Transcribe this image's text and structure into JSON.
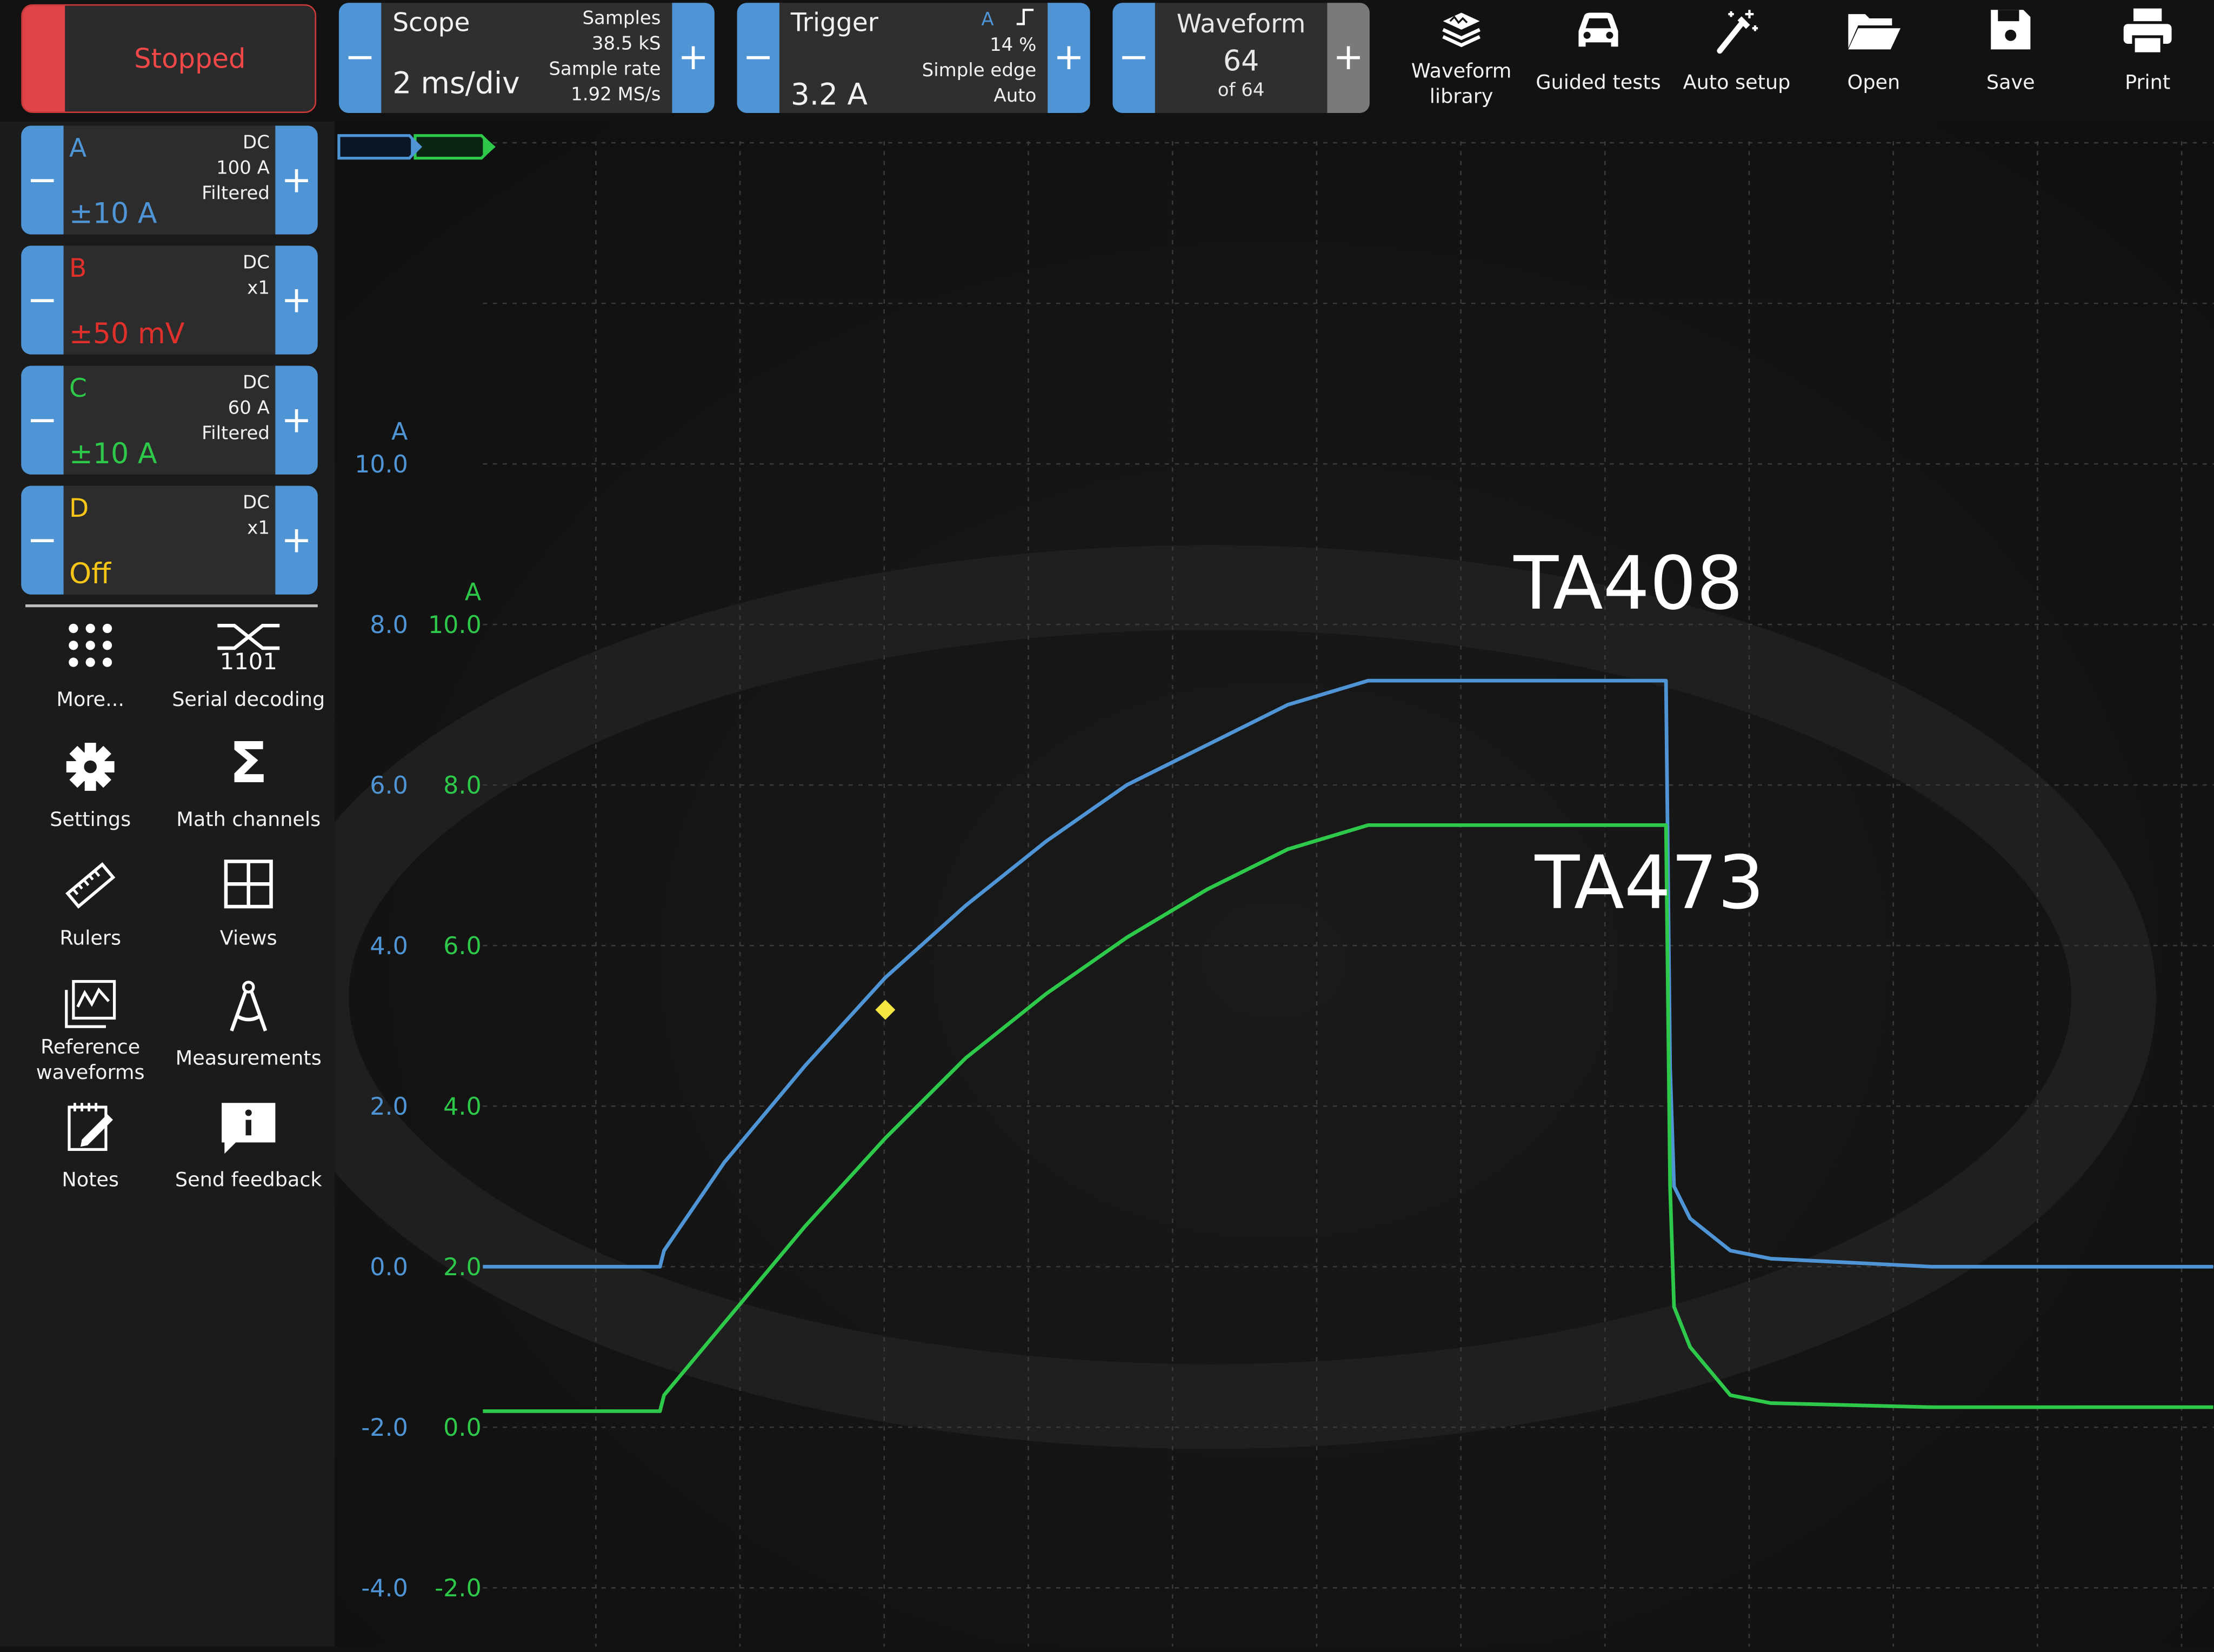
{
  "toolbar": {
    "status": "Stopped",
    "scope": {
      "title": "Scope",
      "timebase": "2 ms/div",
      "samples_label": "Samples",
      "samples": "38.5 kS",
      "rate_label": "Sample rate",
      "rate": "1.92 MS/s"
    },
    "trigger": {
      "title": "Trigger",
      "source": "A",
      "percent": "14 %",
      "type": "Simple edge",
      "mode": "Auto",
      "level": "3.2 A"
    },
    "waveform": {
      "title": "Waveform",
      "current": "64",
      "of": "of 64"
    },
    "tools": [
      {
        "label": "Waveform library",
        "icon": "waveform-library-icon"
      },
      {
        "label": "Guided tests",
        "icon": "car-icon"
      },
      {
        "label": "Auto setup",
        "icon": "magic-wand-icon"
      },
      {
        "label": "Open",
        "icon": "folder-icon"
      },
      {
        "label": "Save",
        "icon": "floppy-icon"
      },
      {
        "label": "Print",
        "icon": "printer-icon"
      }
    ]
  },
  "channels": [
    {
      "letter": "A",
      "coupling": "DC",
      "probe": "100 A",
      "filter": "Filtered",
      "range": "±10 A",
      "color": "#4f95d6"
    },
    {
      "letter": "B",
      "coupling": "DC",
      "probe": "x1",
      "filter": "",
      "range": "±50 mV",
      "color": "#e0302c"
    },
    {
      "letter": "C",
      "coupling": "DC",
      "probe": "60 A",
      "filter": "Filtered",
      "range": "±10 A",
      "color": "#2ec84a"
    },
    {
      "letter": "D",
      "coupling": "DC",
      "probe": "x1",
      "filter": "",
      "range": "Off",
      "color": "#f5c518"
    }
  ],
  "panel": [
    {
      "label": "More...",
      "icon": "dots-grid-icon"
    },
    {
      "label": "Serial decoding",
      "icon": "serial-decoding-icon",
      "glyph": "1101"
    },
    {
      "label": "Settings",
      "icon": "gear-icon"
    },
    {
      "label": "Math channels",
      "icon": "sigma-icon",
      "glyph": "Σ"
    },
    {
      "label": "Rulers",
      "icon": "ruler-icon"
    },
    {
      "label": "Views",
      "icon": "views-grid-icon"
    },
    {
      "label": "Reference waveforms",
      "icon": "reference-waveform-icon"
    },
    {
      "label": "Measurements",
      "icon": "compass-icon"
    },
    {
      "label": "Notes",
      "icon": "notes-icon"
    },
    {
      "label": "Send feedback",
      "icon": "feedback-icon"
    }
  ],
  "chart_data": {
    "type": "line",
    "axis_a": {
      "unit": "A",
      "ticks": [
        "10.0",
        "8.0",
        "6.0",
        "4.0",
        "2.0",
        "0.0",
        "-2.0",
        "-4.0"
      ],
      "color": "#4f95d6"
    },
    "axis_c": {
      "unit": "A",
      "ticks": [
        "10.0",
        "8.0",
        "6.0",
        "4.0",
        "2.0",
        "0.0",
        "-2.0"
      ],
      "color": "#2ec84a"
    },
    "series": [
      {
        "name": "TA408",
        "axis": "A",
        "color": "#4f95d6",
        "points": [
          [
            0,
            0.0
          ],
          [
            2.2,
            0.0
          ],
          [
            2.25,
            0.2
          ],
          [
            3,
            1.3
          ],
          [
            4,
            2.5
          ],
          [
            5,
            3.6
          ],
          [
            6,
            4.5
          ],
          [
            7,
            5.3
          ],
          [
            8,
            6.0
          ],
          [
            9,
            6.5
          ],
          [
            10,
            7.0
          ],
          [
            11,
            7.3
          ],
          [
            12,
            7.3
          ],
          [
            13,
            7.3
          ],
          [
            14,
            7.3
          ],
          [
            14.7,
            7.3
          ],
          [
            14.75,
            2.5
          ],
          [
            14.8,
            1.0
          ],
          [
            15,
            0.6
          ],
          [
            15.5,
            0.2
          ],
          [
            16,
            0.1
          ],
          [
            18,
            0.0
          ],
          [
            21.5,
            0.0
          ]
        ]
      },
      {
        "name": "TA473",
        "axis": "C",
        "color": "#2ec84a",
        "points": [
          [
            0,
            0.2
          ],
          [
            2.2,
            0.2
          ],
          [
            2.25,
            0.4
          ],
          [
            3,
            1.3
          ],
          [
            4,
            2.5
          ],
          [
            5,
            3.6
          ],
          [
            6,
            4.6
          ],
          [
            7,
            5.4
          ],
          [
            8,
            6.1
          ],
          [
            9,
            6.7
          ],
          [
            10,
            7.2
          ],
          [
            11,
            7.5
          ],
          [
            12,
            7.5
          ],
          [
            13,
            7.5
          ],
          [
            14,
            7.5
          ],
          [
            14.7,
            7.5
          ],
          [
            14.75,
            3.0
          ],
          [
            14.8,
            1.5
          ],
          [
            15,
            1.0
          ],
          [
            15.5,
            0.4
          ],
          [
            16,
            0.3
          ],
          [
            18,
            0.25
          ],
          [
            21.5,
            0.25
          ]
        ]
      }
    ],
    "trigger_marker": {
      "x": 5,
      "y": 3.2,
      "color": "#f5e642"
    }
  }
}
